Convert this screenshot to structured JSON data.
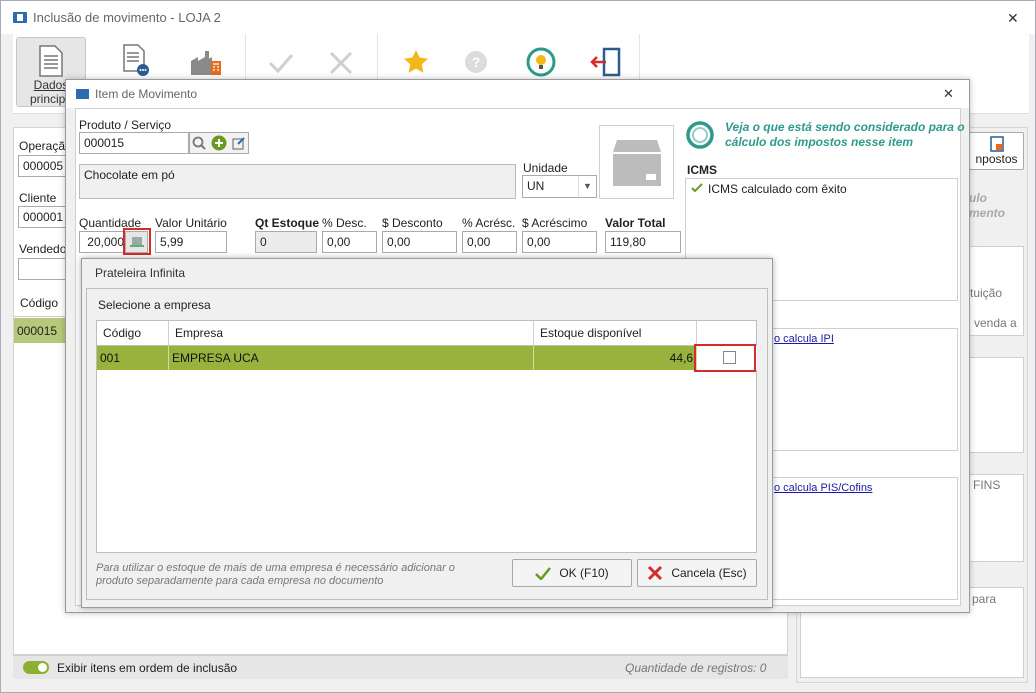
{
  "window": {
    "title": "Inclusão de movimento - LOJA 2",
    "close": "✕"
  },
  "ribbon": {
    "dados_label_1": "Dados",
    "dados_label_2": "principa"
  },
  "background": {
    "operacao_label": "Operaçã",
    "operacao_value": "000005",
    "cliente_label": "Cliente",
    "cliente_value": "000001",
    "vendedor_label": "Vendedor",
    "codigo_header": "Código",
    "codigo_row": "000015",
    "right_btn_label": "npostos",
    "right_partial_1": "ulo",
    "right_partial_2": "mento",
    "right_partial_3": "tuição",
    "right_partial_4": "venda a",
    "right_partial_5": "FINS",
    "right_partial_6": "para"
  },
  "statusbar": {
    "toggle_label": "Exibir itens em ordem de inclusão",
    "count_label": "Quantidade de registros: 0"
  },
  "item_dialog": {
    "title": "Item de Movimento",
    "close": "✕",
    "produto_label": "Produto / Serviço",
    "produto_value": "000015",
    "description": "Chocolate em pó",
    "unidade_label": "Unidade",
    "unidade_value": "UN",
    "quantidade_label": "Quantidade",
    "quantidade_value": "20,000",
    "valor_unit_label": "Valor Unitário",
    "valor_unit_value": "5,99",
    "qt_estoque_label": "Qt Estoque",
    "qt_estoque_value": "0",
    "pct_desc_label": "% Desc.",
    "pct_desc_value": "0,00",
    "desconto_label": "$ Desconto",
    "desconto_value": "0,00",
    "pct_acresc_label": "% Acrésc.",
    "pct_acresc_value": "0,00",
    "acrescimo_label": "$ Acréscimo",
    "acrescimo_value": "0,00",
    "valor_total_label": "Valor Total",
    "valor_total_value": "119,80",
    "tax_hint_1": "Veja o que está sendo considerado para o",
    "tax_hint_2": "cálculo dos impostos nesse item",
    "icms_heading": "ICMS",
    "icms_status": "ICMS calculado com êxito",
    "ipi_link": "o calcula IPI",
    "pis_link": "o calcula PIS/Cofins"
  },
  "prateleira": {
    "title": "Prateleira Infinita",
    "section_label": "Selecione a empresa",
    "columns": [
      "Código",
      "Empresa",
      "Estoque disponível"
    ],
    "rows": [
      {
        "codigo": "001",
        "empresa": "EMPRESA UCA",
        "estoque": "44,6"
      }
    ],
    "footer_note_1": "Para utilizar o estoque de mais de uma empresa é necessário adicionar o",
    "footer_note_2": "produto separadamente para cada empresa no documento",
    "ok_label": "OK (F10)",
    "cancel_label": "Cancela (Esc)"
  },
  "colors": {
    "accent_green": "#97b33d",
    "highlight_red": "#d42b2b",
    "tax_text": "#2f9a8c"
  }
}
